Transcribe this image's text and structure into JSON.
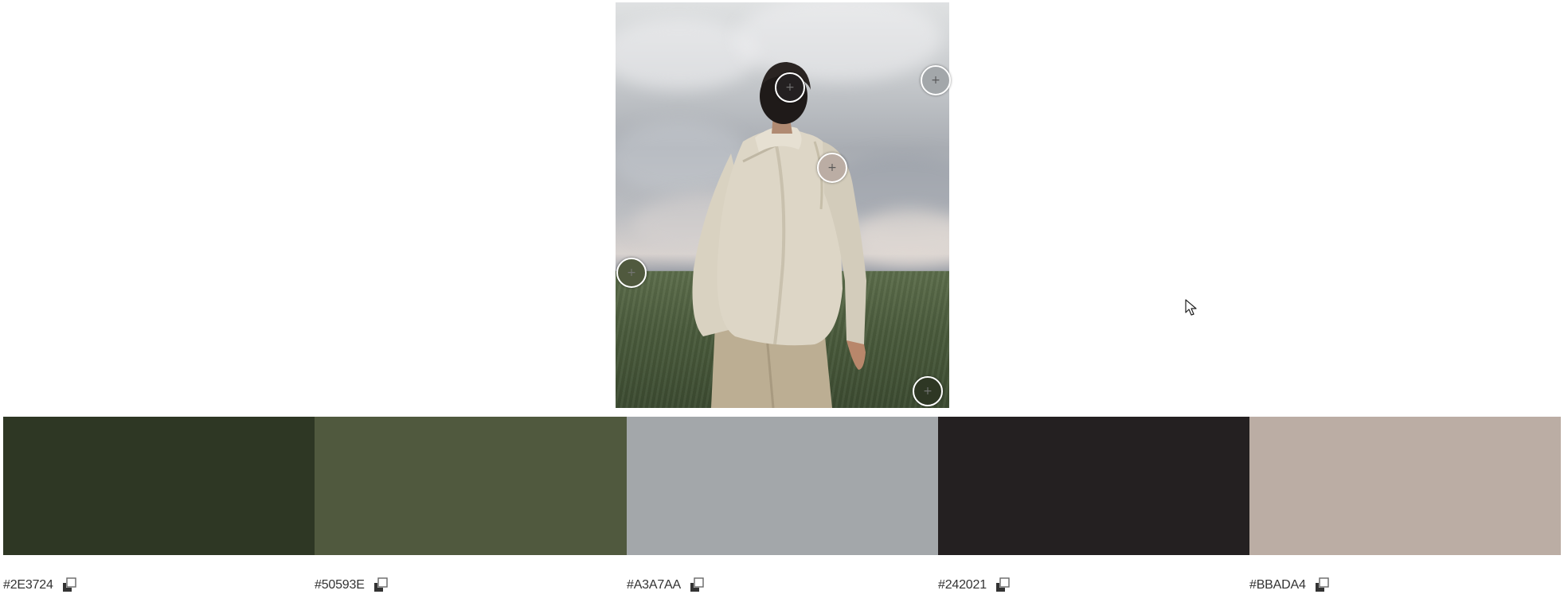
{
  "image": {
    "description_icon": "photo-of-person-in-field"
  },
  "markers": [
    {
      "name": "marker-head",
      "color": "#242021",
      "dark": true
    },
    {
      "name": "marker-sky-right",
      "color": "#A3A7AA",
      "dark": false
    },
    {
      "name": "marker-shirt",
      "color": "#BBADA4",
      "dark": false
    },
    {
      "name": "marker-grass-left",
      "color": "#50593E",
      "dark": true
    },
    {
      "name": "marker-grass-bottom",
      "color": "#2E3724",
      "dark": true
    }
  ],
  "palette": [
    {
      "hex": "#2E3724",
      "color": "#2E3724"
    },
    {
      "hex": "#50593E",
      "color": "#50593E"
    },
    {
      "hex": "#A3A7AA",
      "color": "#A3A7AA"
    },
    {
      "hex": "#242021",
      "color": "#242021"
    },
    {
      "hex": "#BBADA4",
      "color": "#BBADA4"
    }
  ],
  "icons": {
    "copy": "copy-icon",
    "cursor": "mouse-pointer-icon"
  }
}
